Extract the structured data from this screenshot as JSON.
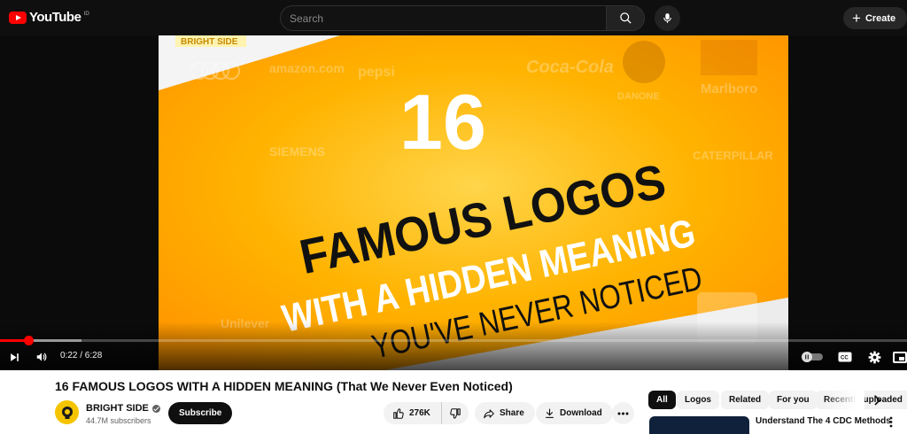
{
  "masthead": {
    "logo_text": "YouTube",
    "region_code": "ID",
    "search_placeholder": "Search",
    "create_label": "Create"
  },
  "player": {
    "thumbnail": {
      "brand": "BRIGHT SIDE",
      "number": "16",
      "line1": "FAMOUS LOGOS",
      "line2_prefix": "WITH A",
      "line2_highlight": "HIDDEN MEANING",
      "line3": "YOU'VE NEVER NOTICED",
      "bg_logos": [
        "amazon.com",
        "Coca-Cola",
        "DANONE",
        "Marlboro",
        "SIEMENS",
        "CATERPILLAR",
        "pepsi",
        "Unilever"
      ]
    },
    "progress": {
      "played_fraction": 0.0317,
      "buffered_fraction": 0.09
    },
    "time_display": "0:22 / 6:28"
  },
  "video": {
    "title": "16 FAMOUS LOGOS WITH A HIDDEN MEANING (That We Never Even Noticed)",
    "channel_name": "BRIGHT SIDE",
    "subscribers": "44.7M subscribers",
    "subscribe_label": "Subscribe",
    "likes": "276K",
    "share_label": "Share",
    "download_label": "Download"
  },
  "filter_chips": [
    "All",
    "Logos",
    "Related",
    "For you",
    "Recently uploaded"
  ],
  "recommendation": {
    "title": "Understand The 4 CDC Methods"
  },
  "colors": {
    "accent": "#ff0000",
    "thumb_yellow": "#ffb300",
    "thumb_dark": "#111111"
  }
}
